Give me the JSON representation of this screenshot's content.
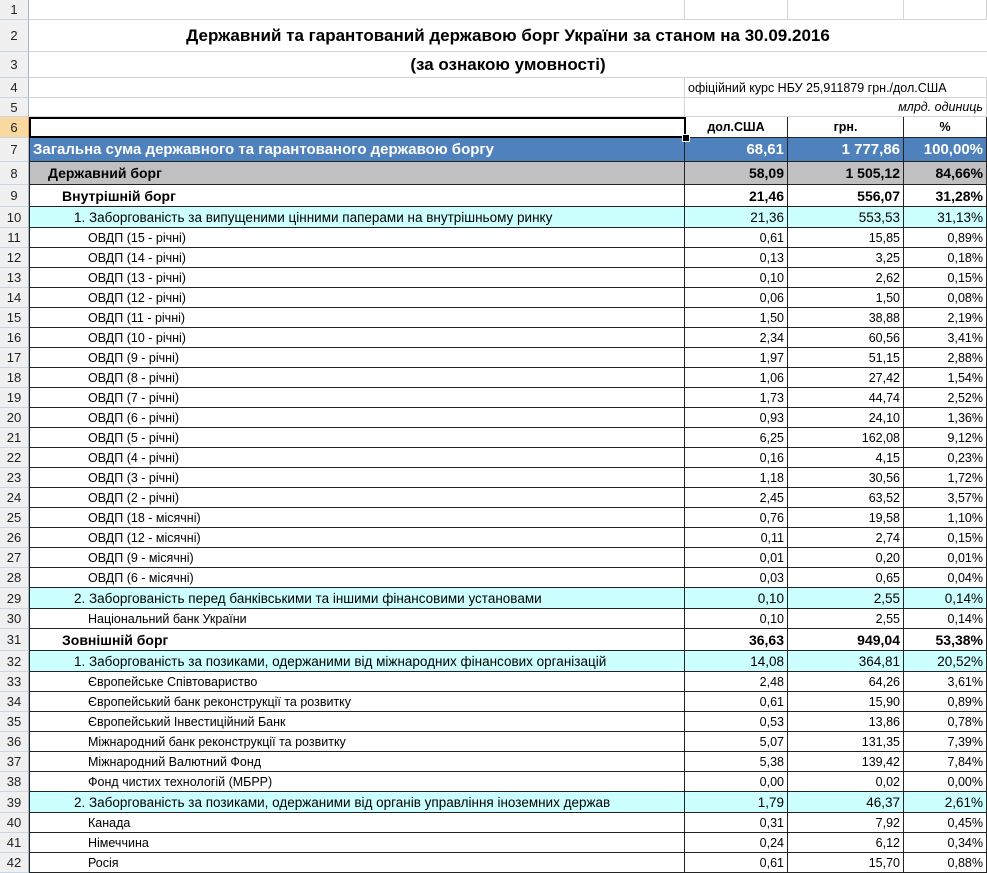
{
  "title_line1": "Державний та гарантований державою борг України за станом на 30.09.2016",
  "title_line2": "(за ознакою умовності)",
  "rate_note": "офіційний курс НБУ  25,911879 грн./дол.США",
  "units_note": "млрд. одиниць",
  "columns": {
    "usd": "дол.США",
    "uah": "грн.",
    "pct": "%"
  },
  "rows": [
    {
      "n": "7",
      "label": "Загальна сума державного та гарантованого державою боргу",
      "usd": "68,61",
      "uah": "1 777,86",
      "pct": "100,00%",
      "lvl": "total",
      "ind": 0
    },
    {
      "n": "8",
      "label": "Державний борг",
      "usd": "58,09",
      "uah": "1 505,12",
      "pct": "84,66%",
      "lvl": "state",
      "ind": 1
    },
    {
      "n": "9",
      "label": "Внутрішній борг",
      "usd": "21,46",
      "uah": "556,07",
      "pct": "31,28%",
      "lvl": "sec",
      "ind": 2
    },
    {
      "n": "10",
      "label": "1. Заборгованість за випущеними цінними паперами на внутрішньому ринку",
      "usd": "21,36",
      "uah": "553,53",
      "pct": "31,13%",
      "lvl": "cat",
      "ind": 3
    },
    {
      "n": "11",
      "label": "ОВДП (15 - річні)",
      "usd": "0,61",
      "uah": "15,85",
      "pct": "0,89%",
      "lvl": "item",
      "ind": 4
    },
    {
      "n": "12",
      "label": "ОВДП (14 - річні)",
      "usd": "0,13",
      "uah": "3,25",
      "pct": "0,18%",
      "lvl": "item",
      "ind": 4
    },
    {
      "n": "13",
      "label": "ОВДП (13 - річні)",
      "usd": "0,10",
      "uah": "2,62",
      "pct": "0,15%",
      "lvl": "item",
      "ind": 4
    },
    {
      "n": "14",
      "label": "ОВДП (12 - річні)",
      "usd": "0,06",
      "uah": "1,50",
      "pct": "0,08%",
      "lvl": "item",
      "ind": 4
    },
    {
      "n": "15",
      "label": "ОВДП (11 - річні)",
      "usd": "1,50",
      "uah": "38,88",
      "pct": "2,19%",
      "lvl": "item",
      "ind": 4
    },
    {
      "n": "16",
      "label": "ОВДП (10 - річні)",
      "usd": "2,34",
      "uah": "60,56",
      "pct": "3,41%",
      "lvl": "item",
      "ind": 4
    },
    {
      "n": "17",
      "label": "ОВДП (9 - річні)",
      "usd": "1,97",
      "uah": "51,15",
      "pct": "2,88%",
      "lvl": "item",
      "ind": 4
    },
    {
      "n": "18",
      "label": "ОВДП (8 - річні)",
      "usd": "1,06",
      "uah": "27,42",
      "pct": "1,54%",
      "lvl": "item",
      "ind": 4
    },
    {
      "n": "19",
      "label": "ОВДП (7 - річні)",
      "usd": "1,73",
      "uah": "44,74",
      "pct": "2,52%",
      "lvl": "item",
      "ind": 4
    },
    {
      "n": "20",
      "label": "ОВДП (6 - річні)",
      "usd": "0,93",
      "uah": "24,10",
      "pct": "1,36%",
      "lvl": "item",
      "ind": 4
    },
    {
      "n": "21",
      "label": "ОВДП (5 - річні)",
      "usd": "6,25",
      "uah": "162,08",
      "pct": "9,12%",
      "lvl": "item",
      "ind": 4
    },
    {
      "n": "22",
      "label": "ОВДП (4 - річні)",
      "usd": "0,16",
      "uah": "4,15",
      "pct": "0,23%",
      "lvl": "item",
      "ind": 4
    },
    {
      "n": "23",
      "label": "ОВДП (3 - річні)",
      "usd": "1,18",
      "uah": "30,56",
      "pct": "1,72%",
      "lvl": "item",
      "ind": 4
    },
    {
      "n": "24",
      "label": "ОВДП (2 - річні)",
      "usd": "2,45",
      "uah": "63,52",
      "pct": "3,57%",
      "lvl": "item",
      "ind": 4
    },
    {
      "n": "25",
      "label": "ОВДП (18 - місячні)",
      "usd": "0,76",
      "uah": "19,58",
      "pct": "1,10%",
      "lvl": "item",
      "ind": 4
    },
    {
      "n": "26",
      "label": "ОВДП (12 - місячні)",
      "usd": "0,11",
      "uah": "2,74",
      "pct": "0,15%",
      "lvl": "item",
      "ind": 4
    },
    {
      "n": "27",
      "label": "ОВДП (9 - місячні)",
      "usd": "0,01",
      "uah": "0,20",
      "pct": "0,01%",
      "lvl": "item",
      "ind": 4
    },
    {
      "n": "28",
      "label": "ОВДП (6 - місячні)",
      "usd": "0,03",
      "uah": "0,65",
      "pct": "0,04%",
      "lvl": "item",
      "ind": 4
    },
    {
      "n": "29",
      "label": "2. Заборгованість перед банківськими та іншими фінансовими установами",
      "usd": "0,10",
      "uah": "2,55",
      "pct": "0,14%",
      "lvl": "cat",
      "ind": 3
    },
    {
      "n": "30",
      "label": "Національний банк України",
      "usd": "0,10",
      "uah": "2,55",
      "pct": "0,14%",
      "lvl": "item",
      "ind": 4
    },
    {
      "n": "31",
      "label": "Зовнішній борг",
      "usd": "36,63",
      "uah": "949,04",
      "pct": "53,38%",
      "lvl": "sec",
      "ind": 2
    },
    {
      "n": "32",
      "label": "1. Заборгованість за позиками, одержаними від міжнародних фінансових організацій",
      "usd": "14,08",
      "uah": "364,81",
      "pct": "20,52%",
      "lvl": "cat",
      "ind": 3
    },
    {
      "n": "33",
      "label": "Європейське Співтовариство",
      "usd": "2,48",
      "uah": "64,26",
      "pct": "3,61%",
      "lvl": "item",
      "ind": 4
    },
    {
      "n": "34",
      "label": "Європейський банк реконструкції та розвитку",
      "usd": "0,61",
      "uah": "15,90",
      "pct": "0,89%",
      "lvl": "item",
      "ind": 4
    },
    {
      "n": "35",
      "label": "Європейський Інвестиційний Банк",
      "usd": "0,53",
      "uah": "13,86",
      "pct": "0,78%",
      "lvl": "item",
      "ind": 4
    },
    {
      "n": "36",
      "label": "Міжнародний банк реконструкції та розвитку",
      "usd": "5,07",
      "uah": "131,35",
      "pct": "7,39%",
      "lvl": "item",
      "ind": 4
    },
    {
      "n": "37",
      "label": "Міжнародний Валютний Фонд",
      "usd": "5,38",
      "uah": "139,42",
      "pct": "7,84%",
      "lvl": "item",
      "ind": 4
    },
    {
      "n": "38",
      "label": "Фонд чистих технологій (МБРР)",
      "usd": "0,00",
      "uah": "0,02",
      "pct": "0,00%",
      "lvl": "item",
      "ind": 4
    },
    {
      "n": "39",
      "label": "2. Заборгованість за позиками, одержаними від органів управління іноземних держав",
      "usd": "1,79",
      "uah": "46,37",
      "pct": "2,61%",
      "lvl": "cat",
      "ind": 3
    },
    {
      "n": "40",
      "label": "Канада",
      "usd": "0,31",
      "uah": "7,92",
      "pct": "0,45%",
      "lvl": "item",
      "ind": 4
    },
    {
      "n": "41",
      "label": "Німеччина",
      "usd": "0,24",
      "uah": "6,12",
      "pct": "0,34%",
      "lvl": "item",
      "ind": 4
    },
    {
      "n": "42",
      "label": "Росія",
      "usd": "0,61",
      "uah": "15,70",
      "pct": "0,88%",
      "lvl": "item",
      "ind": 4
    }
  ]
}
